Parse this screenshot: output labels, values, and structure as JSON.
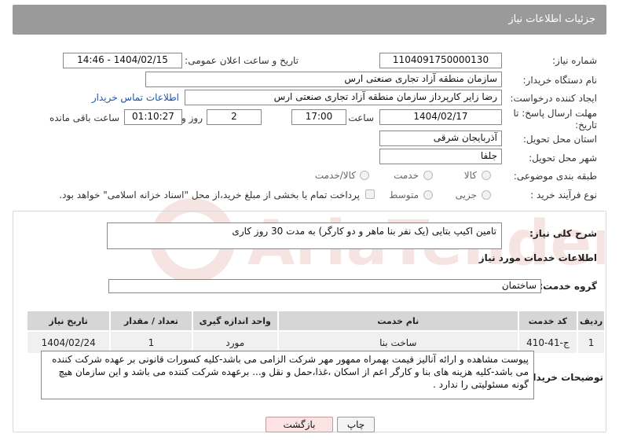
{
  "header": {
    "title": "جزئیات اطلاعات نیاز"
  },
  "form": {
    "need_number_label": "شماره نیاز:",
    "need_number": "1104091750000130",
    "announce_label": "تاریخ و ساعت اعلان عمومی:",
    "announce_value": "1404/02/15 - 14:46",
    "buyer_org_label": "نام دستگاه خریدار:",
    "buyer_org": "سازمان منطقه آزاد تجاری صنعتی ارس",
    "creator_label": "ایجاد کننده درخواست:",
    "creator": "رضا زایر کارپرداز سازمان منطقه آزاد تجاری صنعتی ارس",
    "contact_link": "اطلاعات تماس خریدار",
    "deadline_label": "مهلت ارسال پاسخ: تا تاریخ:",
    "deadline_date": "1404/02/17",
    "time_label": "ساعت",
    "deadline_time": "17:00",
    "days_value": "2",
    "days_label": "روز و",
    "remaining_time": "01:10:27",
    "remaining_label": "ساعت باقی مانده",
    "province_label": "استان محل تحویل:",
    "province": "آذربایجان شرقی",
    "city_label": "شهر محل تحویل:",
    "city": "جلفا",
    "category_label": "طبقه بندی موضوعی:",
    "category_options": [
      "کالا",
      "خدمت",
      "کالا/خدمت"
    ],
    "process_label": "نوع فرآیند خرید :",
    "process_options": [
      "جزیی",
      "متوسط"
    ],
    "payment_note": "پرداخت تمام یا بخشی از مبلغ خرید،از محل \"اسناد خزانه اسلامی\" خواهد بود."
  },
  "description": {
    "label": "شرح کلی نیاز:",
    "text": "تامین اکیپ بتایی (یک نفر بنا ماهر و دو کارگر) به مدت 30 روز کاری"
  },
  "services": {
    "section_title": "اطلاعات خدمات مورد نیاز",
    "group_label": "گروه خدمت:",
    "group_value": "ساختمان",
    "columns": [
      "ردیف",
      "کد خدمت",
      "نام خدمت",
      "واحد اندازه گیری",
      "تعداد / مقدار",
      "تاریخ نیاز"
    ],
    "rows": [
      [
        "1",
        "ج-41-410",
        "ساخت بنا",
        "مورد",
        "1",
        "1404/02/24"
      ]
    ]
  },
  "buyer_notes": {
    "label": "توضیحات خریدار:",
    "text": "پیوست مشاهده و ارائه آنالیز قیمت بهمراه ممهور مهر شرکت الزامی می باشد-کلیه کسورات قانونی بر عهده شرکت کننده می باشد-کلیه هزینه های بنا و کارگر اعم از اسکان ،غذا،حمل و نقل و... برعهده شرکت کننده می باشد و این سازمان هیچ گونه مسئولیتی را ندارد ."
  },
  "buttons": {
    "print": "چاپ",
    "back": "بازگشت"
  },
  "watermark": {
    "text": "AriaTender.net"
  },
  "colors": {
    "header_bg": "#9a9a9a",
    "link": "#1a56b0",
    "back_btn_bg": "#fbe3e3"
  }
}
